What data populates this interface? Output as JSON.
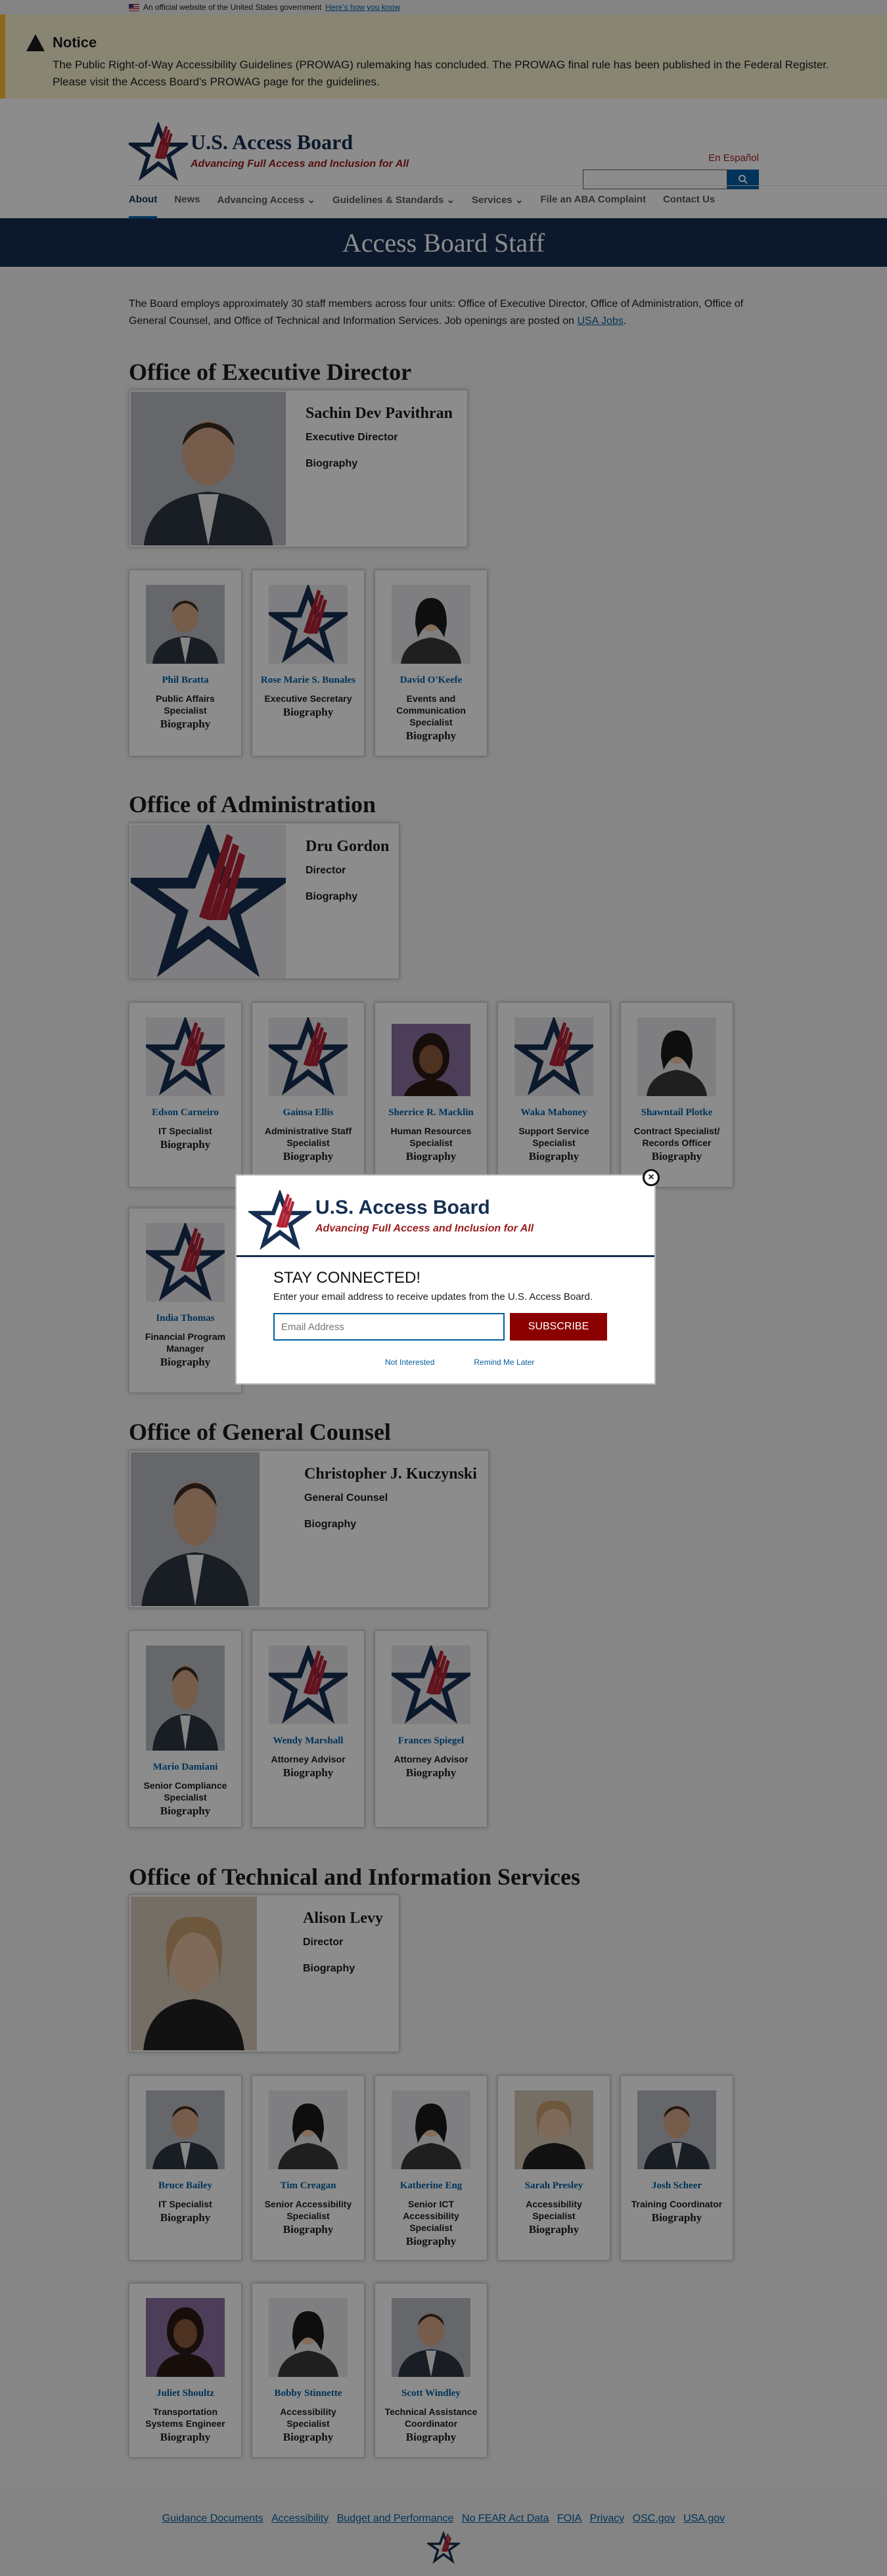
{
  "gov_banner": {
    "text": "An official website of the United States government",
    "link": "Here's how you know"
  },
  "notice": {
    "title": "Notice",
    "text": "The Public Right-of-Way Accessibility Guidelines (PROWAG) rulemaking has concluded. The PROWAG final rule has been published in the Federal Register. Please visit the Access Board's PROWAG page for the guidelines."
  },
  "header": {
    "title": "U.S. Access Board",
    "tagline": "Advancing Full Access and Inclusion for All",
    "espanol": "En Español",
    "nav": [
      "About",
      "News",
      "Advancing Access ⌄",
      "Guidelines & Standards ⌄",
      "Services ⌄",
      "File an ABA Complaint",
      "Contact Us"
    ]
  },
  "page_title": "Access Board Staff",
  "intro": {
    "text": "The Board employs approximately 30 staff members across four units: Office of Executive Director, Office of Administration, Office of General Counsel, and Office of Technical and Information Services. Job openings are posted on ",
    "link": "USA Jobs",
    "end": "."
  },
  "bio_label": "Biography",
  "sections": {
    "exec": {
      "title": "Office of Executive Director",
      "lead": {
        "name": "Sachin Dev Pavithran",
        "role": "Executive Director"
      }
    },
    "admin": {
      "title": "Office of Administration",
      "lead": {
        "name": "Dru Gordon",
        "role": "Director"
      }
    },
    "gc": {
      "title": "Office of General Counsel",
      "lead": {
        "name": "Christopher J. Kuczynski",
        "role": "General Counsel"
      }
    },
    "tis": {
      "title": "Office of Technical and Information Services",
      "lead": {
        "name": "Alison Levy",
        "role": "Director"
      }
    }
  },
  "staff": [
    {
      "name": "Phil Bratta",
      "role": "Public Affairs Specialist"
    },
    {
      "name": "Rose Marie S. Bunales",
      "role": "Executive Secretary"
    },
    {
      "name": "David O'Keefe",
      "role": "Events and Communication Specialist"
    },
    {
      "name": "Edson Carneiro",
      "role": "IT Specialist"
    },
    {
      "name": "Gainsa Ellis",
      "role": "Administrative Staff Specialist"
    },
    {
      "name": "Sherrice R. Macklin",
      "role": "Human Resources Specialist"
    },
    {
      "name": "Waka Mahoney",
      "role": "Support Service Specialist"
    },
    {
      "name": "Shawntail Plotke",
      "role": "Contract Specialist/ Records Officer"
    },
    {
      "name": "India Thomas",
      "role": "Financial Program Manager"
    },
    {
      "name": "Mario Damiani",
      "role": "Senior Compliance Specialist"
    },
    {
      "name": "Wendy Marshall",
      "role": "Attorney Advisor"
    },
    {
      "name": "Frances Spiegel",
      "role": "Attorney Advisor"
    },
    {
      "name": "Bruce Bailey",
      "role": "IT Specialist"
    },
    {
      "name": "Tim Creagan",
      "role": "Senior Accessibility Specialist"
    },
    {
      "name": "Katherine Eng",
      "role": "Senior ICT Accessibility Specialist"
    },
    {
      "name": "Sarah Presley",
      "role": "Accessibility Specialist"
    },
    {
      "name": "Josh Scheer",
      "role": "Training Coordinator"
    },
    {
      "name": "Juliet Shoultz",
      "role": "Transportation Systems Engineer"
    },
    {
      "name": "Bobby Stinnette",
      "role": "Accessibility Specialist"
    },
    {
      "name": "Scott Windley",
      "role": "Technical Assistance Coordinator"
    }
  ],
  "footer": {
    "links": [
      "Guidance Documents",
      "Accessibility",
      "Budget and Performance",
      "No FEAR Act Data",
      "FOIA",
      "Privacy",
      "OSC.gov",
      "USA.gov"
    ]
  },
  "modal": {
    "title": "U.S. Access Board",
    "tagline": "Advancing Full Access and Inclusion for All",
    "heading": "STAY CONNECTED!",
    "text": "Enter your email address to receive updates from the U.S. Access Board.",
    "placeholder": "Email Address",
    "subscribe": "SUBSCRIBE",
    "not_interested": "Not Interested",
    "remind_later": "Remind Me Later",
    "close": "×"
  },
  "colors": {
    "navy": "#162e51",
    "red": "#9b1b1b",
    "link": "#005ea2",
    "notice_bg": "#faf3d1",
    "notice_border": "#ffbe2e"
  }
}
